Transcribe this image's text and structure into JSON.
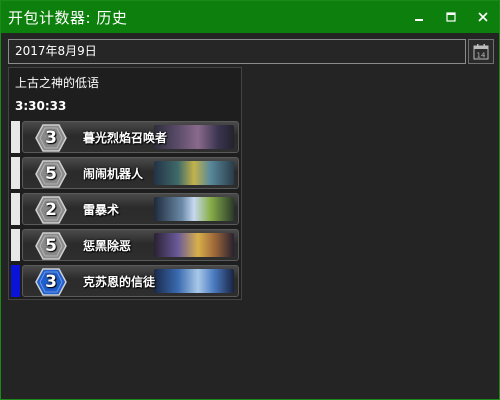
{
  "window": {
    "title": "开包计数器: 历史"
  },
  "date_picker": {
    "value": "2017年8月9日",
    "calendar_day": "14"
  },
  "pack": {
    "name": "上古之神的低语",
    "time": "3:30:33"
  },
  "cards": [
    {
      "cost": "3",
      "name": "暮光烈焰召唤者",
      "rarity_color": "#e8e8e8",
      "gem_color": "#8a8a8a",
      "art": "linear-gradient(90deg, #2e2e3a 0%, #5b4c6a 30%, #8a6a8c 55%, #3a3550 80%, #23232d 100%)"
    },
    {
      "cost": "5",
      "name": "闹闹机器人",
      "rarity_color": "#e8e8e8",
      "gem_color": "#8a8a8a",
      "art": "linear-gradient(90deg, #233347 0%, #3f6a6a 30%, #c2b24a 50%, #5a8a9c 70%, #2a3c4a 100%)"
    },
    {
      "cost": "2",
      "name": "雷暴术",
      "rarity_color": "#e8e8e8",
      "gem_color": "#8a8a8a",
      "art": "linear-gradient(90deg, #1f2a3a 0%, #6a8aa8 35%, #c8d8f0 50%, #8ab04a 70%, #2a3a2a 100%)"
    },
    {
      "cost": "5",
      "name": "惩黑除恶",
      "rarity_color": "#e8e8e8",
      "gem_color": "#8a8a8a",
      "art": "linear-gradient(90deg, #2a2233 0%, #6a5a9a 30%, #d8b04a 55%, #a06a3a 75%, #2a2030 100%)"
    },
    {
      "cost": "3",
      "name": "克苏恩的信徒",
      "rarity_color": "#0a14d8",
      "gem_color": "#1f5fcf",
      "art": "linear-gradient(90deg, #1a2a4a 0%, #3a6ab0 30%, #a8c8e8 55%, #4a7ac0 75%, #1a2440 100%)"
    }
  ],
  "colors": {
    "titlebar": "#0d7f0d",
    "background": "#242424"
  }
}
